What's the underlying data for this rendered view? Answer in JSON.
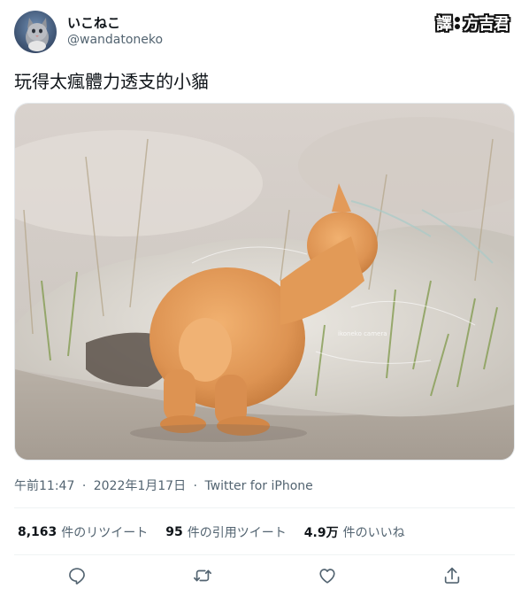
{
  "author": {
    "name": "いこねこ",
    "handle": "@wandatoneko"
  },
  "translator_badge": {
    "left": "譯",
    "right": "方吉君"
  },
  "tweet": {
    "text": "玩得太瘋體力透支的小貓",
    "photo_watermark": "ikoneko camera"
  },
  "meta": {
    "time": "午前11:47",
    "separator": "·",
    "date": "2022年1月17日",
    "client": "Twitter for iPhone"
  },
  "stats": {
    "retweets": {
      "count": "8,163",
      "label": "件のリツイート"
    },
    "quotes": {
      "count": "95",
      "label": "件の引用ツイート"
    },
    "likes": {
      "count": "4.9万",
      "label": "件のいいね"
    }
  },
  "actions": {
    "reply": "reply-icon",
    "retweet": "retweet-icon",
    "like": "heart-icon",
    "share": "share-icon"
  },
  "colors": {
    "text_primary": "#0f1419",
    "text_secondary": "#536471",
    "divider": "#eff3f4"
  }
}
